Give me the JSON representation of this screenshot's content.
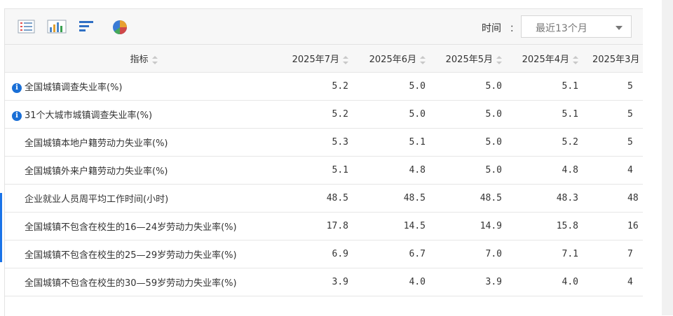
{
  "toolbar": {
    "icons": [
      "table-view-icon",
      "bar-chart-icon",
      "horizontal-bar-icon",
      "pie-chart-icon"
    ],
    "time_label": "时间",
    "time_sep": "：",
    "time_select_value": "最近13个月"
  },
  "table": {
    "header_indicator": "指标",
    "columns": [
      "2025年7月",
      "2025年6月",
      "2025年5月",
      "2025年4月",
      "2025年3月"
    ],
    "rows": [
      {
        "label": "全国城镇调查失业率(%)",
        "info": true,
        "values": [
          "5.2",
          "5.0",
          "5.0",
          "5.1",
          "5"
        ]
      },
      {
        "label": "31个大城市城镇调查失业率(%)",
        "info": true,
        "values": [
          "5.2",
          "5.0",
          "5.0",
          "5.1",
          "5"
        ]
      },
      {
        "label": "全国城镇本地户籍劳动力失业率(%)",
        "info": false,
        "values": [
          "5.3",
          "5.1",
          "5.0",
          "5.2",
          "5"
        ]
      },
      {
        "label": "全国城镇外来户籍劳动力失业率(%)",
        "info": false,
        "values": [
          "5.1",
          "4.8",
          "5.0",
          "4.8",
          "4"
        ]
      },
      {
        "label": "企业就业人员周平均工作时间(小时)",
        "info": false,
        "values": [
          "48.5",
          "48.5",
          "48.5",
          "48.3",
          "48"
        ]
      },
      {
        "label": "全国城镇不包含在校生的16—24岁劳动力失业率(%)",
        "info": false,
        "values": [
          "17.8",
          "14.5",
          "14.9",
          "15.8",
          "16"
        ]
      },
      {
        "label": "全国城镇不包含在校生的25—29岁劳动力失业率(%)",
        "info": false,
        "values": [
          "6.9",
          "6.7",
          "7.0",
          "7.1",
          "7"
        ]
      },
      {
        "label": "全国城镇不包含在校生的30—59岁劳动力失业率(%)",
        "info": false,
        "values": [
          "3.9",
          "4.0",
          "3.9",
          "4.0",
          "4"
        ]
      }
    ]
  }
}
